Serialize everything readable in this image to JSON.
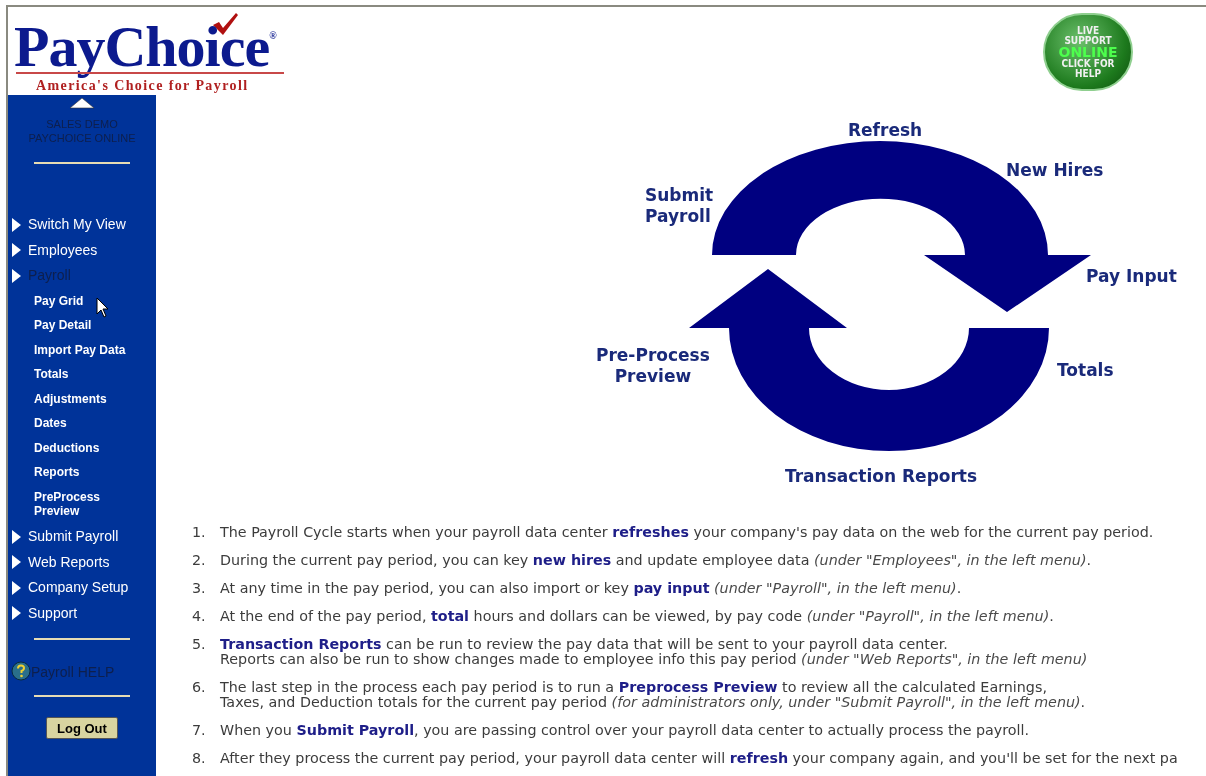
{
  "logo": {
    "name": "PayChoice$^{®}$",
    "tagline": "America's Choice for Payroll"
  },
  "live_support": {
    "lines": [
      "LIVE",
      "SUPPORT",
      "ONLINE",
      "CLICK FOR",
      "HELP"
    ]
  },
  "sidebar": {
    "account_lines": [
      "SALES DEMO",
      "PAYCHOICE ONLINE"
    ],
    "menu": [
      {
        "label": "Switch My View",
        "selected": false
      },
      {
        "label": "Employees",
        "selected": false
      },
      {
        "label": "Payroll",
        "selected": true,
        "children": [
          {
            "label": "Pay Grid"
          },
          {
            "label": "Pay Detail"
          },
          {
            "label": "Import Pay Data"
          },
          {
            "label": "Totals"
          },
          {
            "label": "Adjustments"
          },
          {
            "label": "Dates"
          },
          {
            "label": "Deductions"
          },
          {
            "label": "Reports"
          },
          {
            "label": "PreProcess Preview"
          }
        ]
      },
      {
        "label": "Submit Payroll",
        "selected": false
      },
      {
        "label": "Web Reports",
        "selected": false
      },
      {
        "label": "Company Setup",
        "selected": false
      },
      {
        "label": "Support",
        "selected": false
      }
    ],
    "help": "Payroll HELP",
    "logout": "Log Out"
  },
  "cycle_diagram": {
    "labels": [
      {
        "lines": [
          "Refresh"
        ]
      },
      {
        "lines": [
          "New Hires"
        ]
      },
      {
        "lines": [
          "Submit",
          "Payroll"
        ]
      },
      {
        "lines": [
          "Pay Input"
        ]
      },
      {
        "lines": [
          "Pre-Process",
          "Preview"
        ]
      },
      {
        "lines": [
          "Totals"
        ]
      },
      {
        "lines": [
          "Transaction Reports"
        ]
      }
    ]
  },
  "steps": [
    {
      "number": "1.",
      "lines": [
        "The Payroll Cycle starts when your payroll data center **refreshes** your company's pay data on the web for the current pay period."
      ]
    },
    {
      "number": "2.",
      "lines": [
        "During the current pay period, you can key **new hires** and update employee data *(under \"Employees\", in the left menu)*."
      ]
    },
    {
      "number": "3.",
      "lines": [
        "At any time in the pay period, you can also import or key **pay input** *(under \"Payroll\", in the left menu)*."
      ]
    },
    {
      "number": "4.",
      "lines": [
        "At the end of the pay period, **total** hours and dollars can be viewed, by pay code *(under \"Payroll\", in the left menu)*."
      ]
    },
    {
      "number": "5.",
      "lines": [
        "**Transaction Reports** can be run to review the pay data that will be sent to your payroll data center.",
        "Reports can also be run to show changes made to employee info this pay period *(under \"Web Reports\", in the left menu)*"
      ]
    },
    {
      "number": "6.",
      "lines": [
        "The last step in the process each pay period is to run a **Preprocess Preview** to review all the calculated Earnings,",
        "Taxes, and Deduction totals for the current pay period *(for administrators only, under \"Submit Payroll\", in the left menu)*."
      ]
    },
    {
      "number": "7.",
      "lines": [
        "When you **Submit Payroll**, you are passing control over your payroll data center to actually process the payroll."
      ]
    },
    {
      "number": "8.",
      "lines": [
        "After they process the current pay period, your payroll data center will **refresh** your company again, and you'll be set for the next pa"
      ]
    }
  ]
}
